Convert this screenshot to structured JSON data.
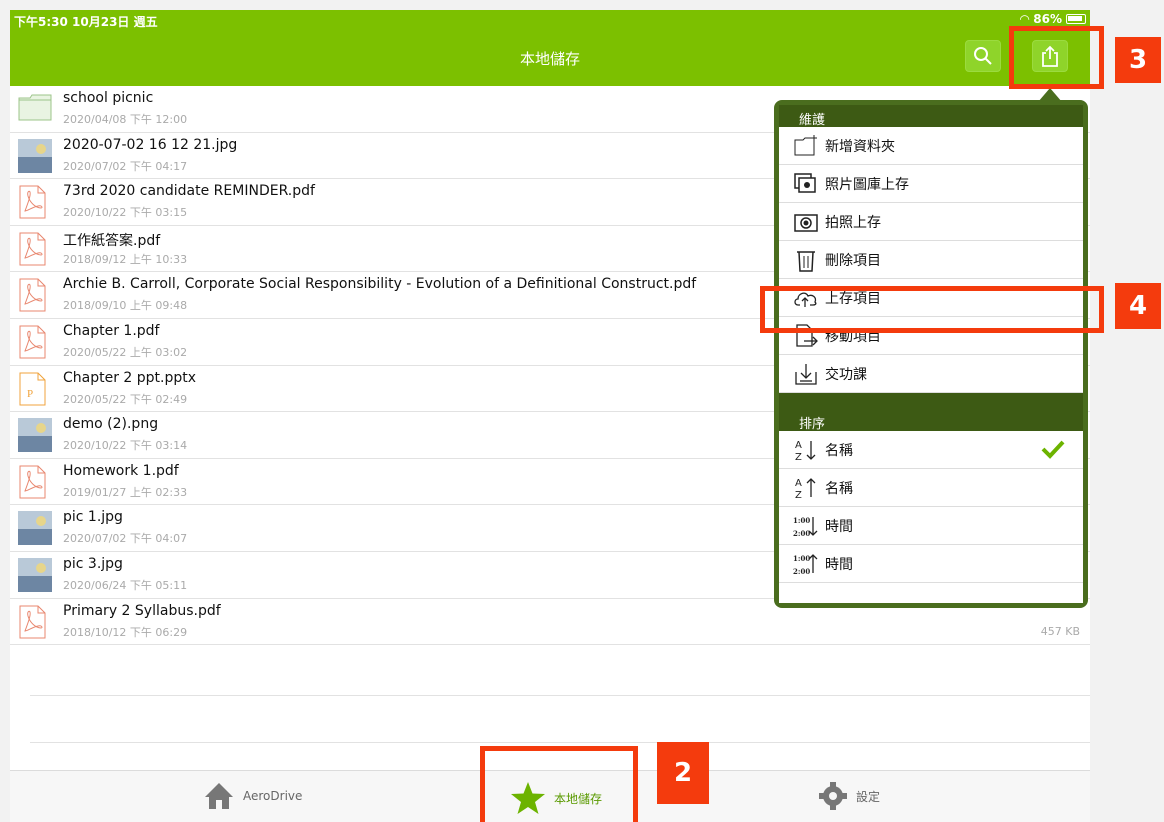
{
  "status": {
    "left": "下午5:30  10月23日 週五",
    "battery": "86%"
  },
  "nav": {
    "title": "本地儲存",
    "search_icon": "search-icon",
    "share_icon": "share-icon"
  },
  "files": [
    {
      "name": "school picnic",
      "date": "2020/04/08 下午 12:00",
      "icon": "folder",
      "size": ""
    },
    {
      "name": "2020-07-02 16 12 21.jpg",
      "date": "2020/07/02 下午 04:17",
      "icon": "image-thumb",
      "size": ""
    },
    {
      "name": "73rd 2020 candidate REMINDER.pdf",
      "date": "2020/10/22 下午 03:15",
      "icon": "pdf",
      "size": ""
    },
    {
      "name": "工作紙答案.pdf",
      "date": "2018/09/12 上午 10:33",
      "icon": "pdf",
      "size": ""
    },
    {
      "name": "Archie B. Carroll, Corporate Social Responsibility - Evolution of a Definitional Construct.pdf",
      "date": "2018/09/10 上午 09:48",
      "icon": "pdf",
      "size": ""
    },
    {
      "name": "Chapter 1.pdf",
      "date": "2020/05/22 上午 03:02",
      "icon": "pdf",
      "size": ""
    },
    {
      "name": "Chapter 2 ppt.pptx",
      "date": "2020/05/22 下午 02:49",
      "icon": "pptx",
      "size": ""
    },
    {
      "name": "demo (2).png",
      "date": "2020/10/22 下午 03:14",
      "icon": "image-thumb",
      "size": ""
    },
    {
      "name": "Homework 1.pdf",
      "date": "2019/01/27 上午 02:33",
      "icon": "pdf",
      "size": ""
    },
    {
      "name": "pic 1.jpg",
      "date": "2020/07/02 下午 04:07",
      "icon": "image-thumb",
      "size": ""
    },
    {
      "name": "pic 3.jpg",
      "date": "2020/06/24 下午 05:11",
      "icon": "image-thumb",
      "size": ""
    },
    {
      "name": "Primary 2 Syllabus.pdf",
      "date": "2018/10/12 下午 06:29",
      "icon": "pdf",
      "size": "457 KB"
    }
  ],
  "menu": {
    "maintenance_header": "維護",
    "items": [
      {
        "label": "新增資料夾",
        "icon": "new-folder-icon"
      },
      {
        "label": "照片圖庫上存",
        "icon": "photo-library-icon"
      },
      {
        "label": "拍照上存",
        "icon": "camera-icon"
      },
      {
        "label": "刪除項目",
        "icon": "trash-icon"
      },
      {
        "label": "上存項目",
        "icon": "cloud-upload-icon"
      },
      {
        "label": "移動項目",
        "icon": "move-file-icon"
      },
      {
        "label": "交功課",
        "icon": "submit-homework-icon"
      }
    ],
    "sort_header": "排序",
    "sort_items": [
      {
        "label": "名稱",
        "icon": "sort-az-down-icon",
        "checked": true
      },
      {
        "label": "名稱",
        "icon": "sort-az-up-icon",
        "checked": false
      },
      {
        "label": "時間",
        "icon": "sort-time-down-icon",
        "checked": false
      },
      {
        "label": "時間",
        "icon": "sort-time-up-icon",
        "checked": false
      }
    ]
  },
  "tabs": [
    {
      "label": "AeroDrive",
      "icon": "home-icon"
    },
    {
      "label": "本地儲存",
      "icon": "star-icon"
    },
    {
      "label": "設定",
      "icon": "gear-icon"
    }
  ],
  "callouts": {
    "tab": "2",
    "share": "3",
    "upload": "4"
  },
  "colors": {
    "brand_green": "#7cc000",
    "popover_border": "#4a6d1e",
    "callout": "#f43b0d"
  }
}
